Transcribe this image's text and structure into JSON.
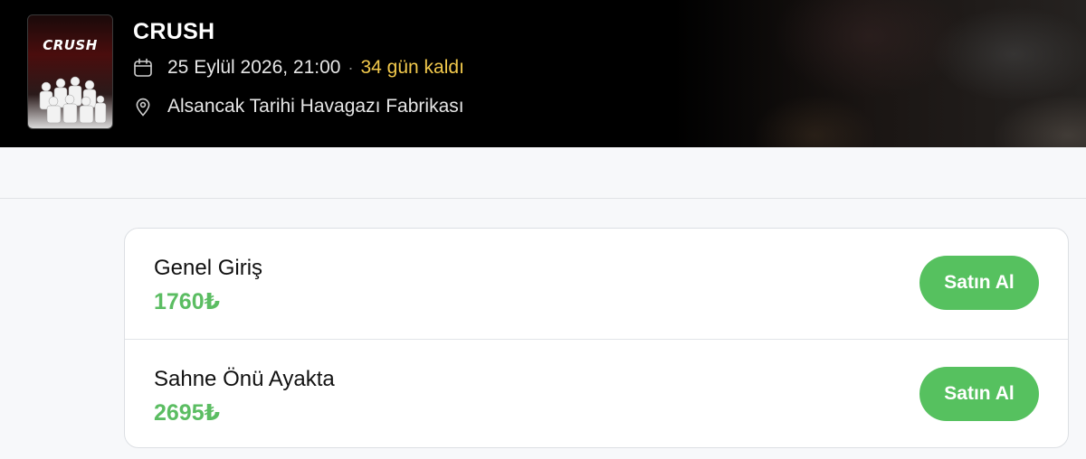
{
  "event": {
    "title": "CRUSH",
    "poster_logo": "CRUSH",
    "date_text": "25 Eylül 2026, 21:00",
    "separator": "·",
    "remaining_text": "34 gün kaldı",
    "venue": "Alsancak Tarihi Havagazı Fabrikası",
    "icons": {
      "date": "calendar-icon",
      "venue": "location-pin-icon"
    }
  },
  "tickets": [
    {
      "name": "Genel Giriş",
      "price": "1760₺",
      "button_label": "Satın Al"
    },
    {
      "name": "Sahne Önü Ayakta",
      "price": "2695₺",
      "button_label": "Satın Al"
    }
  ],
  "colors": {
    "remaining": "#f2c94c",
    "price": "#5bbd62",
    "button": "#56c15f",
    "hero_bg": "#000000"
  }
}
